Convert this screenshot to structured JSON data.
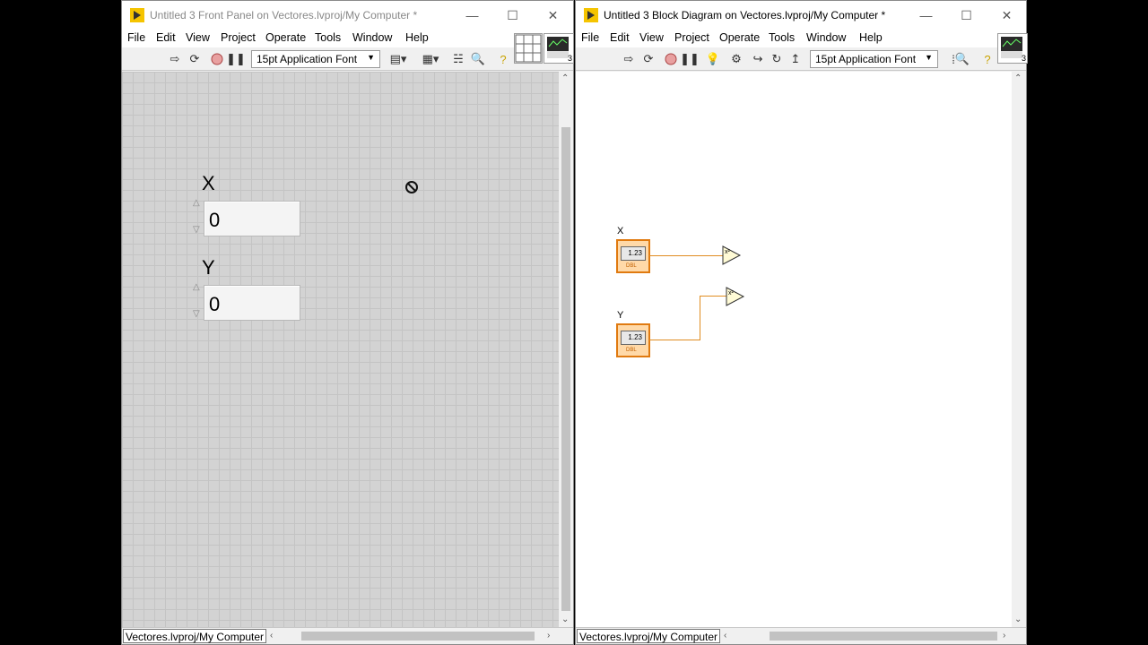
{
  "front_panel": {
    "title": "Untitled 3 Front Panel on Vectores.lvproj/My Computer *",
    "menu": [
      "File",
      "Edit",
      "View",
      "Project",
      "Operate",
      "Tools",
      "Window",
      "Help"
    ],
    "font": "15pt Application Font",
    "icon_badge": "3",
    "controls": [
      {
        "label": "X",
        "value": "0"
      },
      {
        "label": "Y",
        "value": "0"
      }
    ],
    "context": "Vectores.lvproj/My Computer"
  },
  "block_diagram": {
    "title": "Untitled 3 Block Diagram on Vectores.lvproj/My Computer *",
    "menu": [
      "File",
      "Edit",
      "View",
      "Project",
      "Operate",
      "Tools",
      "Window",
      "Help"
    ],
    "font": "15pt Application Font",
    "icon_badge": "3",
    "terminals": [
      {
        "label": "X",
        "display": "1.23",
        "type": "DBL"
      },
      {
        "label": "Y",
        "display": "1.23",
        "type": "DBL"
      }
    ],
    "square_function": "x²",
    "context": "Vectores.lvproj/My Computer"
  },
  "colors": {
    "wire": "#e08c20",
    "terminal_border": "#e07a10",
    "panel_grid": "#d3d3d3"
  }
}
